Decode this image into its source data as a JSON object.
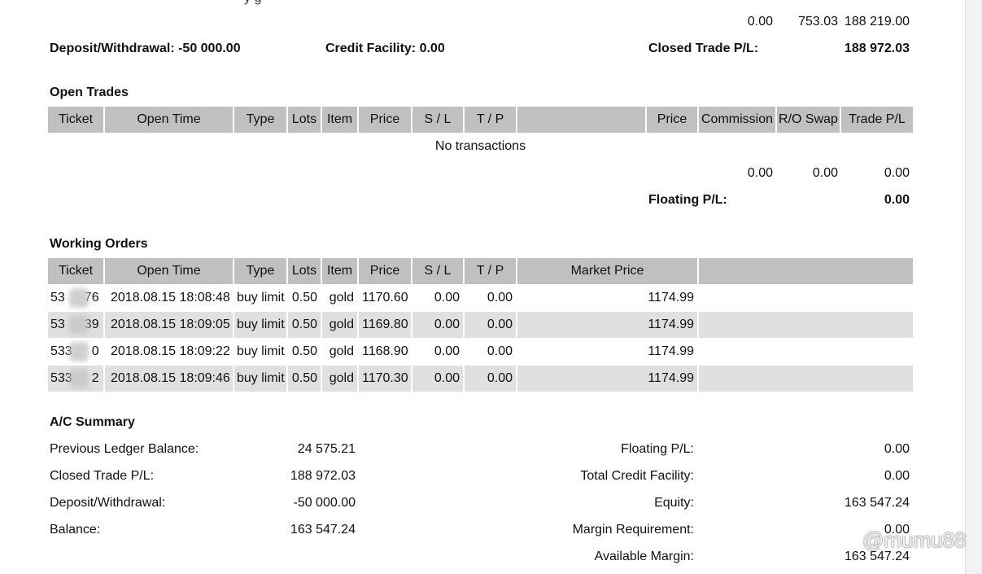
{
  "top": {
    "cut_text": "y        g",
    "totals": [
      "0.00",
      "753.03",
      "188 219.00"
    ]
  },
  "summary_line": {
    "deposit": "Deposit/Withdrawal: -50 000.00",
    "credit": "Credit Facility: 0.00",
    "closed_label": "Closed Trade P/L:",
    "closed_value": "188 972.03"
  },
  "open_trades": {
    "title": "Open Trades",
    "headers": [
      "Ticket",
      "Open Time",
      "Type",
      "Lots",
      "Item",
      "Price",
      "S / L",
      "T / P",
      "",
      "Price",
      "Commission",
      "R/O Swap",
      "Trade P/L"
    ],
    "empty": "No transactions",
    "totals": [
      "0.00",
      "0.00",
      "0.00"
    ],
    "floating_label": "Floating P/L:",
    "floating_value": "0.00"
  },
  "working_orders": {
    "title": "Working Orders",
    "headers": [
      "Ticket",
      "Open Time",
      "Type",
      "Lots",
      "Item",
      "Price",
      "S / L",
      "T / P",
      "Market Price",
      ""
    ],
    "rows": [
      {
        "ticket_a": "53",
        "ticket_b": "76",
        "time": "2018.08.15 18:08:48",
        "type": "buy limit",
        "lots": "0.50",
        "item": "gold",
        "price": "1170.60",
        "sl": "0.00",
        "tp": "0.00",
        "market": "1174.99"
      },
      {
        "ticket_a": "53",
        "ticket_b": "39",
        "time": "2018.08.15 18:09:05",
        "type": "buy limit",
        "lots": "0.50",
        "item": "gold",
        "price": "1169.80",
        "sl": "0.00",
        "tp": "0.00",
        "market": "1174.99"
      },
      {
        "ticket_a": "533",
        "ticket_b": "0",
        "time": "2018.08.15 18:09:22",
        "type": "buy limit",
        "lots": "0.50",
        "item": "gold",
        "price": "1168.90",
        "sl": "0.00",
        "tp": "0.00",
        "market": "1174.99"
      },
      {
        "ticket_a": "533",
        "ticket_b": "2",
        "time": "2018.08.15 18:09:46",
        "type": "buy limit",
        "lots": "0.50",
        "item": "gold",
        "price": "1170.30",
        "sl": "0.00",
        "tp": "0.00",
        "market": "1174.99"
      }
    ]
  },
  "ac_summary": {
    "title": "A/C Summary",
    "left": [
      {
        "label": "Previous Ledger Balance:",
        "value": "24 575.21"
      },
      {
        "label": "Closed Trade P/L:",
        "value": "188 972.03"
      },
      {
        "label": "Deposit/Withdrawal:",
        "value": "-50 000.00"
      },
      {
        "label": "Balance:",
        "value": "163 547.24"
      }
    ],
    "right": [
      {
        "label": "Floating P/L:",
        "value": "0.00"
      },
      {
        "label": "Total Credit Facility:",
        "value": "0.00"
      },
      {
        "label": "Equity:",
        "value": "163 547.24"
      },
      {
        "label": "Margin Requirement:",
        "value": "0.00"
      },
      {
        "label": "Available Margin:",
        "value": "163 547.24"
      }
    ]
  },
  "watermark": "@mumu88",
  "watermark_icon": "weibo-icon"
}
